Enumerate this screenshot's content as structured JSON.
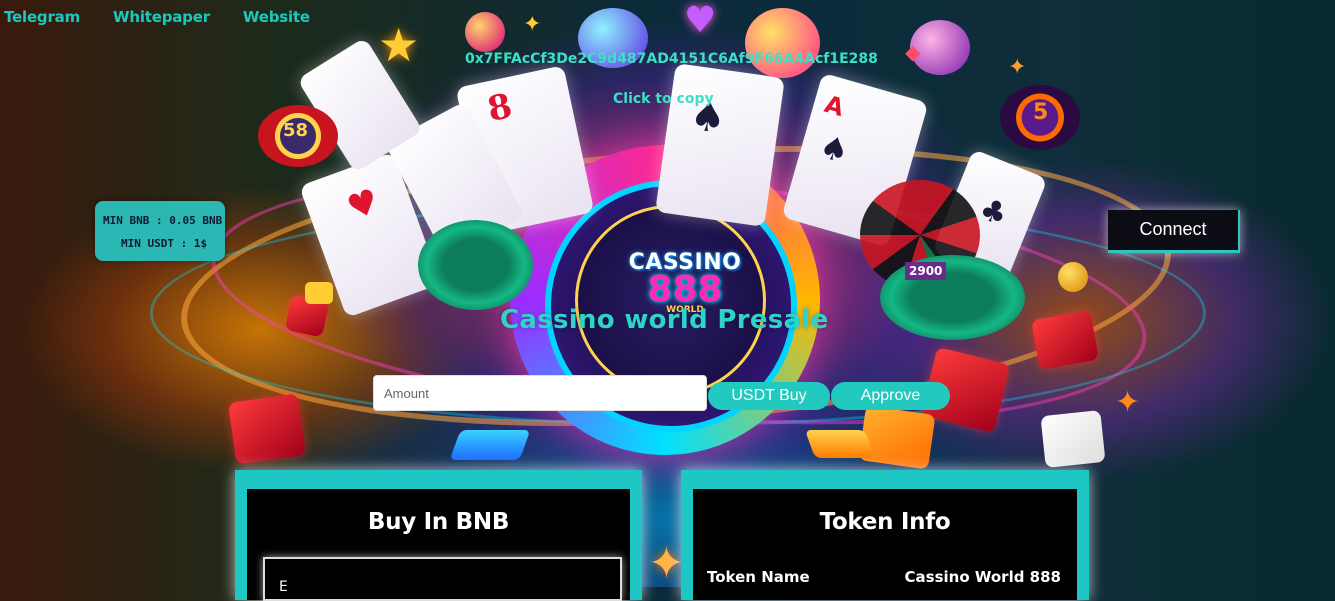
{
  "nav": {
    "telegram": "Telegram",
    "whitepaper": "Whitepaper",
    "website": "Website"
  },
  "contract": {
    "address": "0x7FFAcCf3De2C9d487AD4151C6Af9F66A4Acf1E288",
    "copy_label": "Click to copy"
  },
  "minimums": {
    "bnb": "MIN BNB : 0.05 BNB",
    "usdt": "MIN USDT : 1$"
  },
  "connect_label": "Connect",
  "logo": {
    "top": "CASSINO",
    "number": "888",
    "sub": "WORLD"
  },
  "presale": {
    "title": "Cassino world Presale",
    "amount_placeholder": "Amount",
    "usdt_buy_label": "USDT Buy",
    "approve_label": "Approve"
  },
  "buy_panel": {
    "title": "Buy In BNB",
    "partial_text": "E"
  },
  "token_panel": {
    "title": "Token Info",
    "name_label": "Token Name",
    "name_value": "Cassino World 888"
  },
  "decor": {
    "dice_text": "2900",
    "chip_a": "58",
    "chip_b": "5"
  },
  "colors": {
    "accent": "#22c9be",
    "panel": "#1ec7c3",
    "nav": "#19c9bf"
  }
}
